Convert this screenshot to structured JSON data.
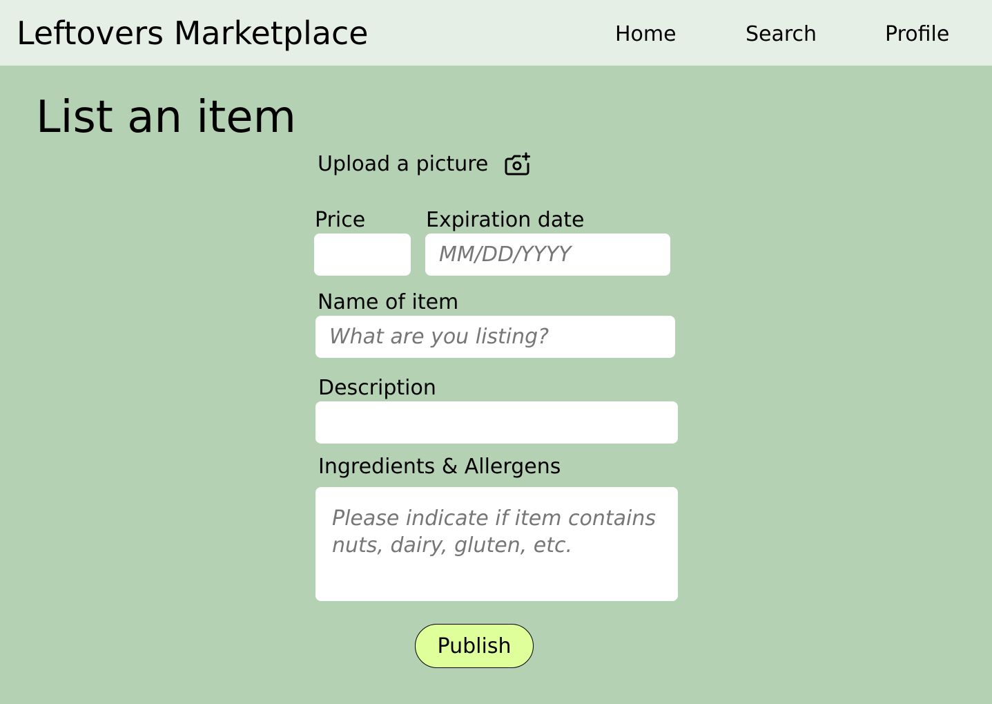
{
  "header": {
    "app_title": "Leftovers Marketplace",
    "nav": {
      "home": "Home",
      "search": "Search",
      "profile": "Profile"
    }
  },
  "page": {
    "title": "List an item"
  },
  "form": {
    "upload": {
      "label": "Upload a picture",
      "icon": "camera-plus-icon"
    },
    "price": {
      "label": "Price",
      "value": "",
      "placeholder": ""
    },
    "expiration": {
      "label": "Expiration date",
      "value": "",
      "placeholder": "MM/DD/YYYY"
    },
    "name": {
      "label": "Name of item",
      "value": "",
      "placeholder": "What are you listing?"
    },
    "description": {
      "label": "Description",
      "value": "",
      "placeholder": ""
    },
    "ingredients": {
      "label": "Ingredients & Allergens",
      "value": "",
      "placeholder": "Please indicate if item contains nuts, dairy, gluten, etc."
    },
    "publish_label": "Publish"
  },
  "colors": {
    "background": "#b5d1b3",
    "header_background": "#e6efe6",
    "input_background": "#ffffff",
    "publish_button": "#dfff9a"
  }
}
